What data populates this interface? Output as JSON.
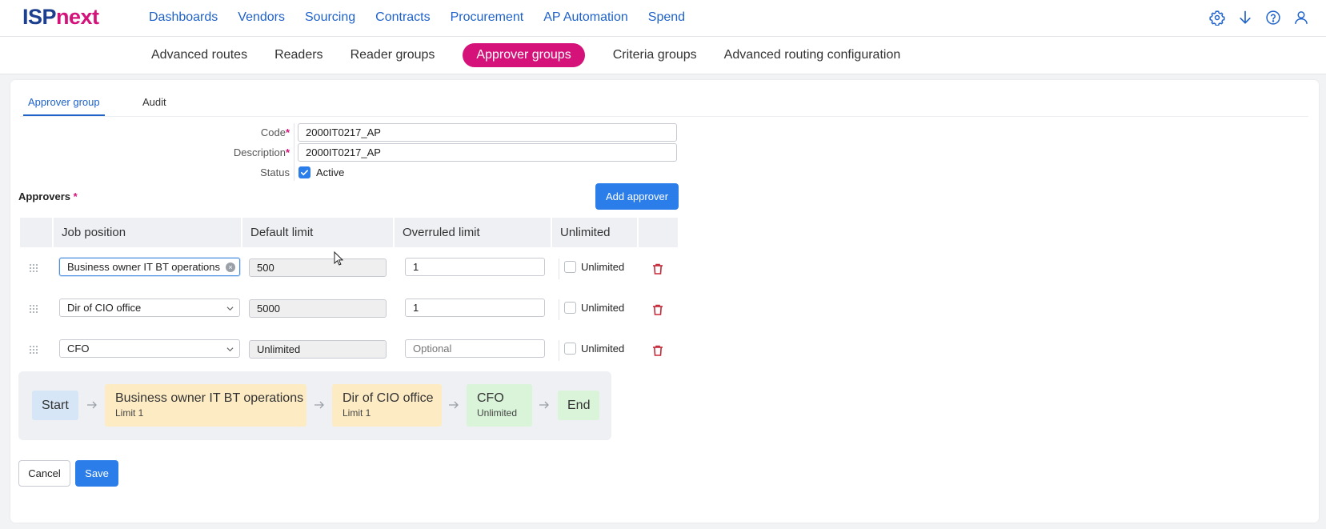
{
  "header": {
    "logo_part1": "ISP",
    "logo_part2": "next",
    "nav": [
      "Dashboards",
      "Vendors",
      "Sourcing",
      "Contracts",
      "Procurement",
      "AP Automation",
      "Spend"
    ],
    "icons": [
      "gear-icon",
      "download-icon",
      "help-icon",
      "user-icon"
    ]
  },
  "subnav": {
    "items": [
      "Advanced routes",
      "Readers",
      "Reader groups",
      "Approver groups",
      "Criteria groups",
      "Advanced routing configuration"
    ],
    "active": "Approver groups"
  },
  "tabs": [
    "Approver group",
    "Audit"
  ],
  "form": {
    "code_label": "Code",
    "code_value": "2000IT0217_AP",
    "description_label": "Description",
    "description_value": "2000IT0217_AP",
    "status_label": "Status",
    "status_value": "Active",
    "required_mark": "*"
  },
  "approvers": {
    "title": "Approvers",
    "add_button": "Add approver",
    "columns": [
      "Job position",
      "Default limit",
      "Overruled limit",
      "Unlimited"
    ],
    "rows": [
      {
        "job_position": "Business owner IT BT operations",
        "default_limit": "500",
        "overruled_limit": "1",
        "overruled_placeholder": "",
        "unlimited_label": "Unlimited"
      },
      {
        "job_position": "Dir of CIO office",
        "default_limit": "5000",
        "overruled_limit": "1",
        "overruled_placeholder": "",
        "unlimited_label": "Unlimited"
      },
      {
        "job_position": "CFO",
        "default_limit": "Unlimited",
        "overruled_limit": "",
        "overruled_placeholder": "Optional",
        "unlimited_label": "Unlimited"
      }
    ]
  },
  "flow": {
    "start": "Start",
    "steps": [
      {
        "title": "Business owner IT BT operations",
        "sub": "Limit 1"
      },
      {
        "title": "Dir of CIO office",
        "sub": "Limit 1"
      },
      {
        "title": "CFO",
        "sub": "Unlimited"
      }
    ],
    "end": "End"
  },
  "footer": {
    "cancel": "Cancel",
    "save": "Save"
  },
  "colors": {
    "brand_blue": "#1d3f8f",
    "brand_pink": "#d4127a",
    "link_blue": "#1f62c9",
    "primary_button": "#2b7de9",
    "delete_red": "#c62838"
  }
}
